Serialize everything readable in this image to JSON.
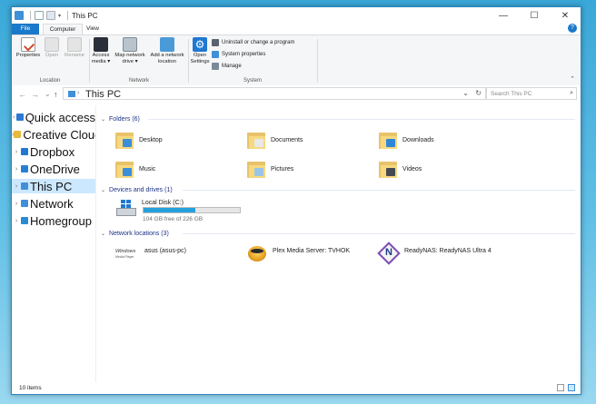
{
  "window": {
    "title": "This PC"
  },
  "tabs": [
    {
      "label": "File"
    },
    {
      "label": "Computer"
    },
    {
      "label": "View"
    }
  ],
  "help_label": "?",
  "ribbon": {
    "location": {
      "label": "Location",
      "buttons": [
        {
          "label": "Properties",
          "enabled": true
        },
        {
          "label": "Open",
          "enabled": false
        },
        {
          "label": "Rename",
          "enabled": false
        }
      ]
    },
    "network": {
      "label": "Network",
      "buttons": [
        {
          "label_top": "Access",
          "label_bottom": "media ▾"
        },
        {
          "label_top": "Map network",
          "label_bottom": "drive ▾"
        },
        {
          "label_top": "Add a network",
          "label_bottom": "location"
        }
      ]
    },
    "system": {
      "label": "System",
      "open_top": "Open",
      "open_bottom": "Settings",
      "small": [
        {
          "label": "Uninstall or change a program"
        },
        {
          "label": "System properties"
        },
        {
          "label": "Manage"
        }
      ]
    }
  },
  "address": {
    "back": "←",
    "forward": "→",
    "recent": "⌄",
    "up": "↑",
    "path": "This PC",
    "dropdown": "⌄",
    "refresh": "↻",
    "search_placeholder": "Search This PC"
  },
  "nav_pane": [
    {
      "label": "Quick access",
      "color": "#2d7ad6",
      "selected": false
    },
    {
      "label": "Creative Cloud Files",
      "color": "#e9b93c",
      "selected": false
    },
    {
      "label": "Dropbox",
      "color": "#1f78d1",
      "selected": false
    },
    {
      "label": "OneDrive",
      "color": "#2680d6",
      "selected": false
    },
    {
      "label": "This PC",
      "color": "#3f90d8",
      "selected": true
    },
    {
      "label": "Network",
      "color": "#3f90d8",
      "selected": false
    },
    {
      "label": "Homegroup",
      "color": "#2a8ad4",
      "selected": false
    }
  ],
  "groups": {
    "folders": "Folders (6)",
    "devices": "Devices and drives (1)",
    "network": "Network locations (3)"
  },
  "folders": [
    {
      "label": "Desktop",
      "badge": "#3b8fd8"
    },
    {
      "label": "Documents",
      "badge": "#e8e8e8"
    },
    {
      "label": "Downloads",
      "badge": "#2f86d6"
    },
    {
      "label": "Music",
      "badge": "#3b8fd8"
    },
    {
      "label": "Pictures",
      "badge": "#9bc4e8"
    },
    {
      "label": "Videos",
      "badge": "#444a52"
    }
  ],
  "drive": {
    "label": "Local Disk (C:)",
    "free_text": "104 GB free of 226 GB",
    "used_fraction": 0.54,
    "bar_color": "#26a0da"
  },
  "network_locations": [
    {
      "label": "asus (asus-pc)",
      "icon": "windows-media-player-icon",
      "logo_line1": "Windows",
      "logo_line2": "Media Player"
    },
    {
      "label": "Plex Media Server: TVHOK",
      "icon": "plex-icon"
    },
    {
      "label": "ReadyNAS: ReadyNAS Ultra 4",
      "icon": "readynas-icon",
      "logo_letter": "N"
    }
  ],
  "status": {
    "items": "10 items"
  },
  "window_buttons": {
    "minimize": "—",
    "maximize": "☐",
    "close": "✕"
  }
}
